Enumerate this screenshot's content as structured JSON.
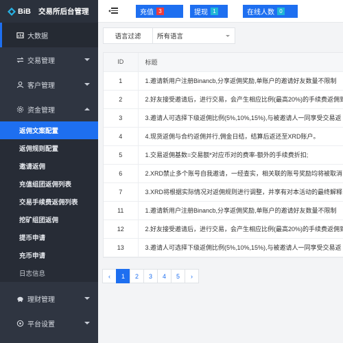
{
  "brand": {
    "logo_text": "BiB",
    "title": "交易所后台管理"
  },
  "sidebar": {
    "items": [
      {
        "label": "大数据",
        "icon": "dashboard-icon"
      },
      {
        "label": "交易管理",
        "icon": "exchange-icon"
      },
      {
        "label": "客户管理",
        "icon": "user-icon"
      },
      {
        "label": "资金管理",
        "icon": "settings-icon"
      },
      {
        "label": "理财管理",
        "icon": "piggy-bank-icon"
      },
      {
        "label": "平台设置",
        "icon": "gear-icon"
      }
    ],
    "submenu": [
      "返佣文案配置",
      "返佣规则配置",
      "邀请返佣",
      "充值组团返佣列表",
      "交易手续费返佣列表",
      "挖矿组团返佣",
      "提币申请",
      "充币申请",
      "日志信息"
    ]
  },
  "topbar": {
    "stats": [
      {
        "label": "充值",
        "count": "3"
      },
      {
        "label": "提现",
        "count": "1"
      },
      {
        "label": "在线人数",
        "count": "0"
      }
    ]
  },
  "filter": {
    "label": "语言过滤",
    "value": "所有语言"
  },
  "table": {
    "headers": [
      "ID",
      "标题"
    ],
    "rows": [
      {
        "id": "1",
        "title": "1.邀请新用户注册Binancb,分享返佣奖励,单账户的邀请好友数量不限制"
      },
      {
        "id": "2",
        "title": "2.好友接受邀请后，进行交易，会产生相应比例(最高20%)的手续费返佣到"
      },
      {
        "id": "3",
        "title": "3.邀请人可选择下级返佣比例(5%,10%,15%),与被邀请人一同享受交易返"
      },
      {
        "id": "4",
        "title": "4.现货返佣与合约返佣并行,佣金日结，结算后返还至XRD账户。"
      },
      {
        "id": "5",
        "title": "1.交易返佣基数=交易额*对应币对的费率-额外的手续费折扣;"
      },
      {
        "id": "6",
        "title": "2.XRD禁止多个账号自我邀请，一经查实，相关联的账号奖励均将被取消"
      },
      {
        "id": "7",
        "title": "3.XRD将根据实际情况对返佣规则进行调整，并享有对本活动的最终解释"
      },
      {
        "id": "11",
        "title": "1.邀请新用户注册Binancb,分享返佣奖励,单账户的邀请好友数量不限制"
      },
      {
        "id": "12",
        "title": "2.好友接受邀请后，进行交易，会产生相应比例(最高20%)的手续费返佣到"
      },
      {
        "id": "13",
        "title": "3.邀请人可选择下级返佣比例(5%,10%,15%),与被邀请人一同享受交易返"
      }
    ]
  },
  "pagination": {
    "prev": "‹",
    "pages": [
      "1",
      "2",
      "3",
      "4",
      "5"
    ],
    "next": "›",
    "current": "1"
  },
  "colors": {
    "sidebar": "#2f3541",
    "accent": "#1e6ff0",
    "badge_red": "#ef3b3b",
    "badge_cyan": "#1fb6d6"
  }
}
